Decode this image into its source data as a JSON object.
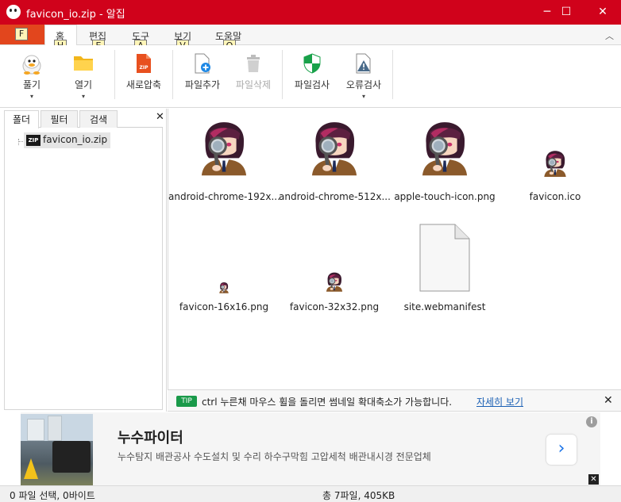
{
  "window": {
    "title": "favicon_io.zip - 알집",
    "minimize": "─",
    "maximize": "☐",
    "close": "✕"
  },
  "menu": {
    "file_keytip": "F",
    "items": [
      {
        "label": "홈",
        "keytip": "H"
      },
      {
        "label": "편집",
        "keytip": "E"
      },
      {
        "label": "도구",
        "keytip": "A"
      },
      {
        "label": "보기",
        "keytip": "V"
      },
      {
        "label": "도움말",
        "keytip": "O"
      }
    ],
    "collapse": "︿"
  },
  "ribbon": {
    "buttons": [
      {
        "label": "풀기",
        "dropdown": "▾",
        "icon": "unzip-mascot-icon"
      },
      {
        "label": "열기",
        "dropdown": "▾",
        "icon": "folder-icon"
      },
      {
        "label": "새로압축",
        "icon": "zip-file-icon"
      },
      {
        "label": "파일추가",
        "icon": "add-file-icon"
      },
      {
        "label": "파일삭제",
        "icon": "trash-icon",
        "disabled": true
      },
      {
        "label": "파일검사",
        "icon": "shield-icon"
      },
      {
        "label": "오류검사",
        "dropdown": "▾",
        "icon": "warning-file-icon"
      }
    ]
  },
  "leftpane": {
    "tabs": [
      "폴더",
      "필터",
      "검색"
    ],
    "close": "✕",
    "tree_item": "favicon_io.zip",
    "zip_badge": "ZIP"
  },
  "files": [
    {
      "name": "android-chrome-192x...",
      "thumb": "large"
    },
    {
      "name": "android-chrome-512x...",
      "thumb": "large"
    },
    {
      "name": "apple-touch-icon.png",
      "thumb": "large"
    },
    {
      "name": "favicon.ico",
      "thumb": "medium"
    },
    {
      "name": "favicon-16x16.png",
      "thumb": "tiny"
    },
    {
      "name": "favicon-32x32.png",
      "thumb": "small"
    },
    {
      "name": "site.webmanifest",
      "thumb": "document"
    }
  ],
  "tipbar": {
    "badge": "TIP",
    "text": "ctrl 누른채 마우스 휠을 돌리면 썸네일 확대축소가 가능합니다.",
    "link": "자세히 보기",
    "close": "✕"
  },
  "ad": {
    "title": "누수파이터",
    "description": "누수탐지 배관공사 수도설치 및 수리 하수구막힘 고압세척 배관내시경 전문업체",
    "arrow": "›",
    "info": "i",
    "close": "✕"
  },
  "status": {
    "left": "0 파일 선택,  0바이트",
    "center": "총 7파일,  405KB"
  },
  "colors": {
    "titlebar": "#d0021b",
    "file_button": "#e2461d",
    "tip_badge": "#1a9a4a",
    "link": "#1a5fb4"
  }
}
